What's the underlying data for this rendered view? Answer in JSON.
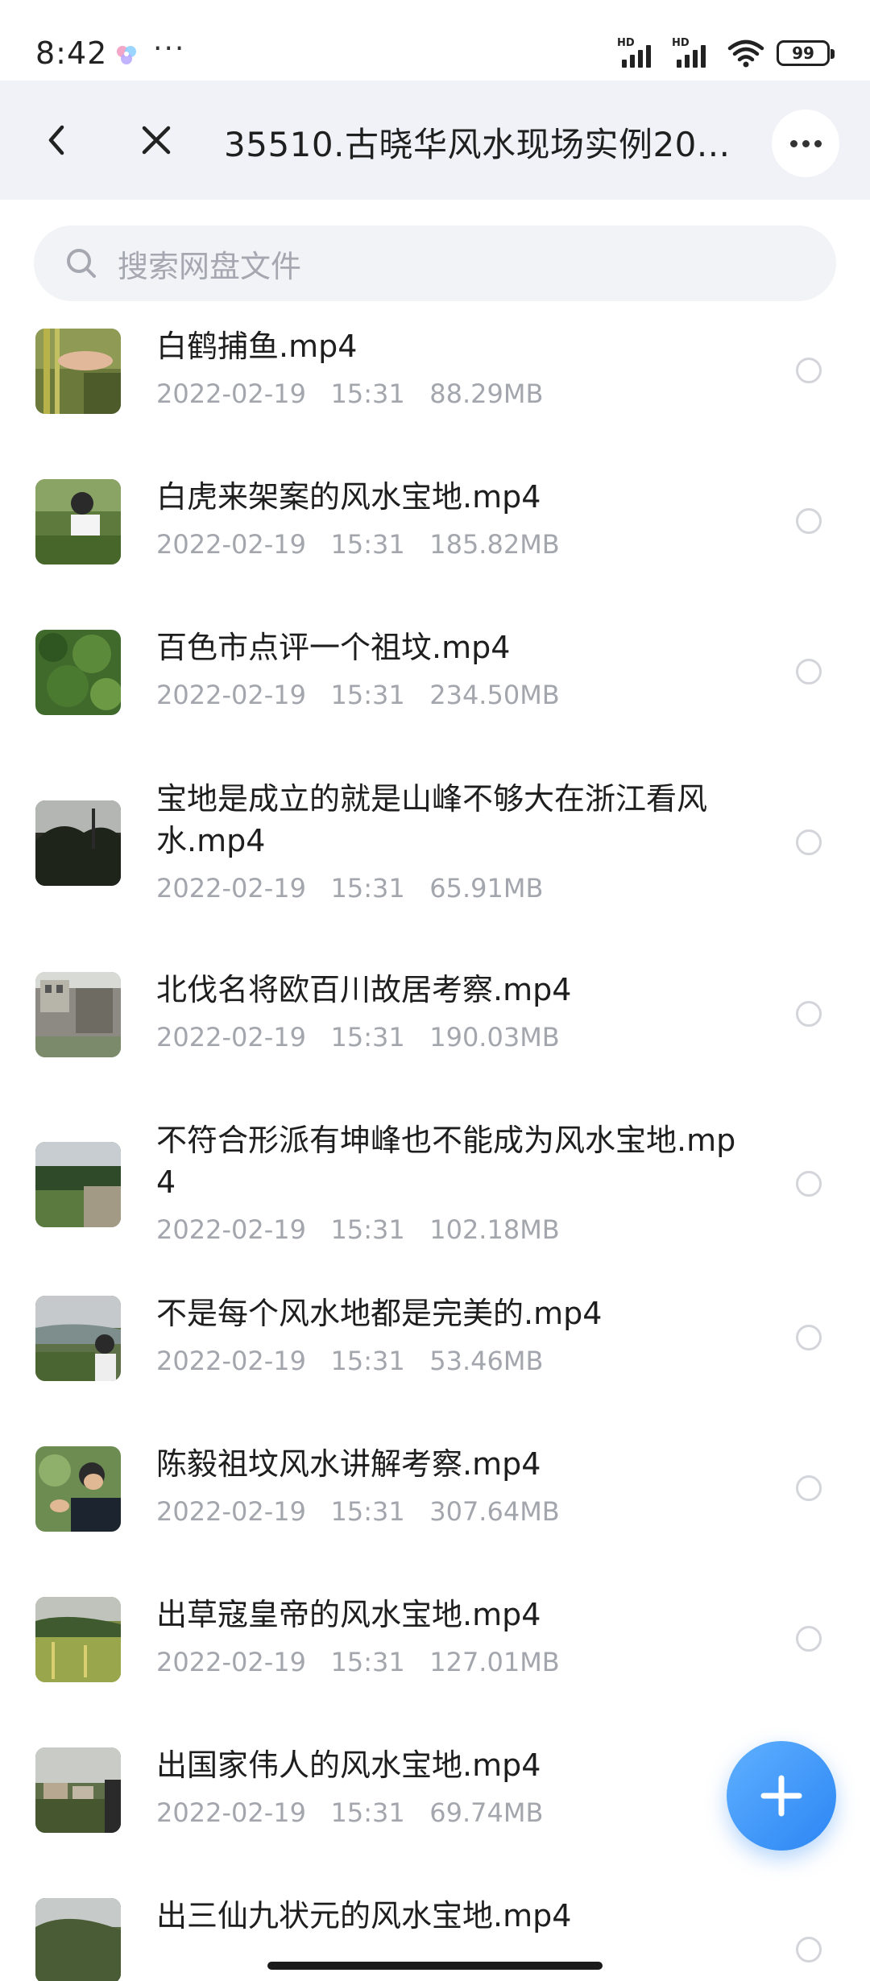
{
  "status_bar": {
    "time": "8:42",
    "dots": "···",
    "battery": "99"
  },
  "header": {
    "title": "35510.古晓华风水现场实例20...",
    "back_icon": "chevron-left-icon",
    "close_icon": "close-icon",
    "more_icon": "more-horizontal-icon",
    "background": "#f1f2f7"
  },
  "search": {
    "placeholder": "搜索网盘文件",
    "icon": "search-icon"
  },
  "files": [
    {
      "name": "白鹤捕鱼.mp4",
      "date": "2022-02-19",
      "time": "15:31",
      "size": "88.29MB"
    },
    {
      "name": "白虎来架案的风水宝地.mp4",
      "date": "2022-02-19",
      "time": "15:31",
      "size": "185.82MB"
    },
    {
      "name": "百色市点评一个祖坟.mp4",
      "date": "2022-02-19",
      "time": "15:31",
      "size": "234.50MB"
    },
    {
      "name": "宝地是成立的就是山峰不够大在浙江看风水.mp4",
      "date": "2022-02-19",
      "time": "15:31",
      "size": "65.91MB"
    },
    {
      "name": "北伐名将欧百川故居考察.mp4",
      "date": "2022-02-19",
      "time": "15:31",
      "size": "190.03MB"
    },
    {
      "name": "不符合形派有坤峰也不能成为风水宝地.mp4",
      "date": "2022-02-19",
      "time": "15:31",
      "size": "102.18MB"
    },
    {
      "name": "不是每个风水地都是完美的.mp4",
      "date": "2022-02-19",
      "time": "15:31",
      "size": "53.46MB"
    },
    {
      "name": "陈毅祖坟风水讲解考察.mp4",
      "date": "2022-02-19",
      "time": "15:31",
      "size": "307.64MB"
    },
    {
      "name": "出草寇皇帝的风水宝地.mp4",
      "date": "2022-02-19",
      "time": "15:31",
      "size": "127.01MB"
    },
    {
      "name": "出国家伟人的风水宝地.mp4",
      "date": "2022-02-19",
      "time": "15:31",
      "size": "69.74MB"
    },
    {
      "name": "出三仙九状元的风水宝地.mp4",
      "date": "",
      "time": "",
      "size": ""
    }
  ],
  "fab": {
    "icon": "plus-icon",
    "color": "#2c86f4"
  }
}
